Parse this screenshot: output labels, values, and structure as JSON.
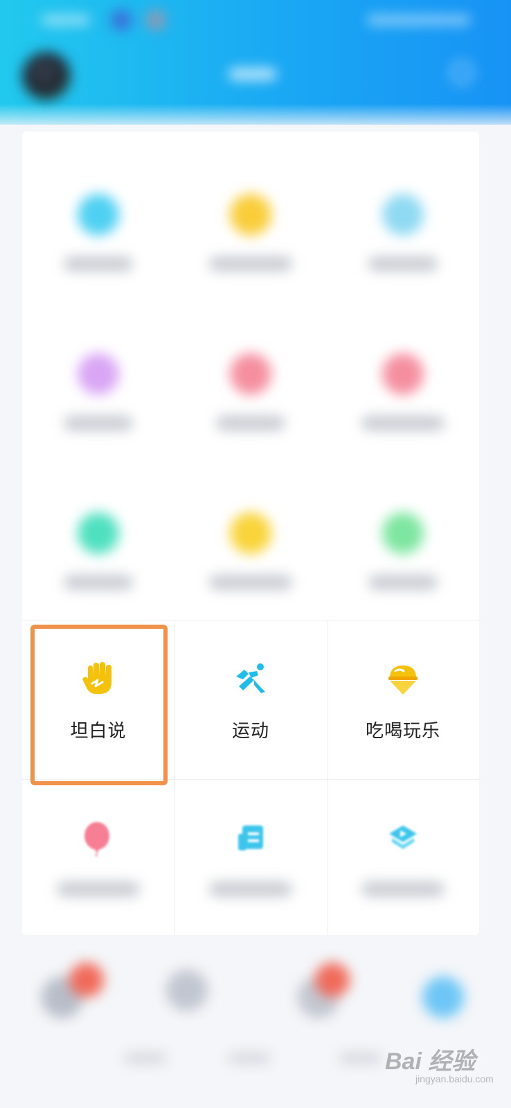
{
  "feature_grid": {
    "items": [
      {
        "label": "坦白说",
        "icon": "confession-hand-icon",
        "color": "#f5c20b",
        "highlighted": true
      },
      {
        "label": "运动",
        "icon": "running-person-icon",
        "color": "#1fbde8",
        "highlighted": false
      },
      {
        "label": "吃喝玩乐",
        "icon": "ice-cream-icon",
        "color": "#f5c20b",
        "highlighted": false
      }
    ]
  },
  "colors": {
    "header_start": "#22c9ee",
    "header_end": "#1793f5",
    "highlight_border": "#f0924a",
    "panel_bg": "#ffffff"
  },
  "watermark": {
    "brand": "Bai 经验",
    "url": "jingyan.baidu.com"
  }
}
